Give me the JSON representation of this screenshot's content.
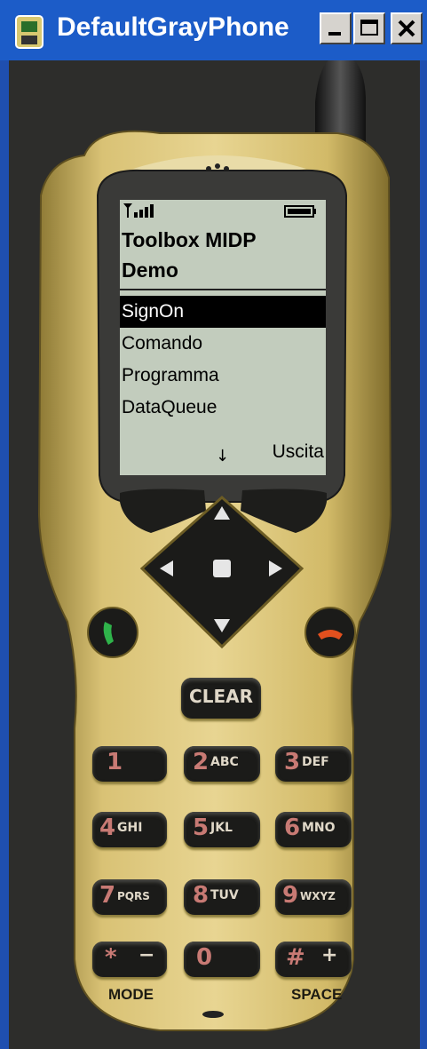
{
  "window": {
    "title": "DefaultGrayPhone"
  },
  "screen": {
    "heading_line1": "Toolbox MIDP",
    "heading_line2": "Demo",
    "menu": [
      {
        "label": "SignOn",
        "selected": true
      },
      {
        "label": "Comando",
        "selected": false
      },
      {
        "label": "Programma",
        "selected": false
      },
      {
        "label": "DataQueue",
        "selected": false
      }
    ],
    "softkey_right": "Uscita",
    "scroll_indicator": "↓"
  },
  "keypad": {
    "clear_label": "CLEAR",
    "keys": [
      {
        "num": "1",
        "letters": ""
      },
      {
        "num": "2",
        "letters": "ABC"
      },
      {
        "num": "3",
        "letters": "DEF"
      },
      {
        "num": "4",
        "letters": "GHI"
      },
      {
        "num": "5",
        "letters": "JKL"
      },
      {
        "num": "6",
        "letters": "MNO"
      },
      {
        "num": "7",
        "letters": "PQRS"
      },
      {
        "num": "8",
        "letters": "TUV"
      },
      {
        "num": "9",
        "letters": "WXYZ"
      },
      {
        "num": "*",
        "letters": "−"
      },
      {
        "num": "0",
        "letters": ""
      },
      {
        "num": "#",
        "letters": "+"
      }
    ],
    "mode_label": "MODE",
    "space_label": "SPACE"
  },
  "colors": {
    "titlebar": "#1c5cc8",
    "phone_body": "#cdb35e",
    "screen_bg": "#c2ccbd",
    "key_bg": "#1b1b19",
    "call_green": "#2fb34a",
    "end_red": "#e3501e"
  },
  "icons": [
    "phone-app-icon",
    "minimize-icon",
    "maximize-icon",
    "close-icon",
    "signal-icon",
    "battery-icon",
    "call-icon",
    "end-call-icon"
  ]
}
